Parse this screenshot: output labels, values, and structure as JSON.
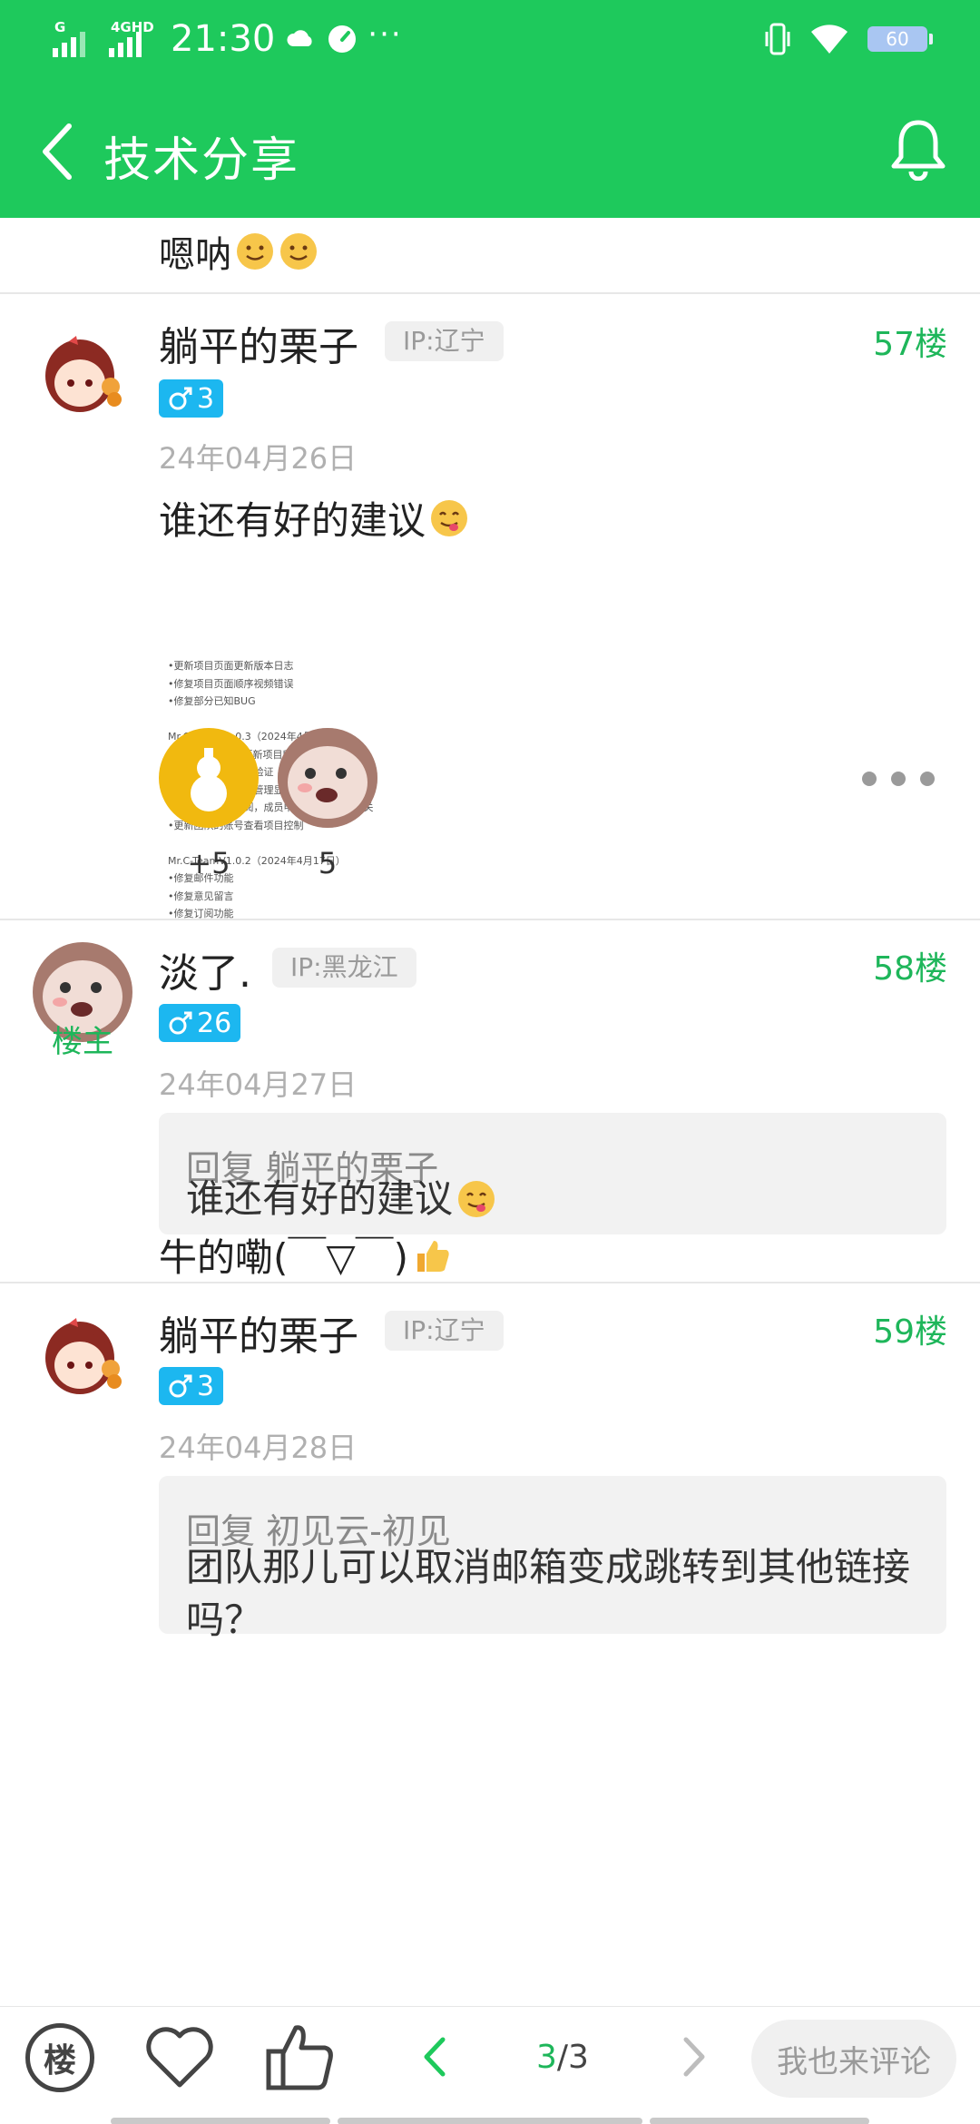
{
  "status_bar": {
    "signal1_label": "G",
    "signal2_label": "4GHD",
    "time": "21:30",
    "battery": "60"
  },
  "app_bar": {
    "title": "技术分享"
  },
  "previous_reply_tail": {
    "text": "嗯呐"
  },
  "posts": [
    {
      "username": "躺平的栗子",
      "ip": "IP:辽宁",
      "floor": "57楼",
      "badge_level": "3",
      "date": "24年04月26日",
      "text": "谁还有好的建议",
      "image_changelog": [
        "•更新项目页面更新版本日志",
        "•修复项目页面顺序视频错误",
        "•修复部分已知BUG",
        "",
        "Mr.C-TeamV1.0.3（2024年4月18日）",
        "•更新发件逻辑 •更新项目所属显示",
        "•更新留言页面人机验证",
        "•更新订阅记录显示管理显示",
        "•更新留言页，订阅，成员申请，后台控制开关",
        "•更新团队的账号查看项目控制",
        "",
        "Mr.C-TeamV1.0.2（2024年4月17日）",
        "•修复邮件功能",
        "•修复意见留言",
        "•修复订阅功能"
      ],
      "reactions": [
        {
          "count": "+5"
        },
        {
          "count": "5"
        }
      ]
    },
    {
      "username": "淡了.",
      "ip": "IP:黑龙江",
      "floor": "58楼",
      "badge_level": "26",
      "owner_tag": "楼主",
      "date": "24年04月27日",
      "quote_head": "回复 躺平的栗子",
      "quote_text": "谁还有好的建议",
      "text": "牛的嘞(￣▽￣)"
    },
    {
      "username": "躺平的栗子",
      "ip": "IP:辽宁",
      "floor": "59楼",
      "badge_level": "3",
      "date": "24年04月28日",
      "quote_head": "回复 初见云-初见",
      "quote_text": "团队那儿可以取消邮箱变成跳转到其他链接吗？"
    }
  ],
  "bottom_bar": {
    "floor_label": "楼",
    "page_current": "3",
    "page_sep_total": "/3",
    "comment_placeholder": "我也来评论"
  },
  "colors": {
    "brand_green": "#1ec95c",
    "accent_green_text": "#1eb65a",
    "badge_blue": "#1cb7f0"
  },
  "icons": [
    "back-arrow-icon",
    "bell-icon",
    "heart-icon",
    "thumb-up-icon",
    "chevron-left-icon",
    "chevron-right-icon",
    "more-icon",
    "gourd-icon"
  ]
}
